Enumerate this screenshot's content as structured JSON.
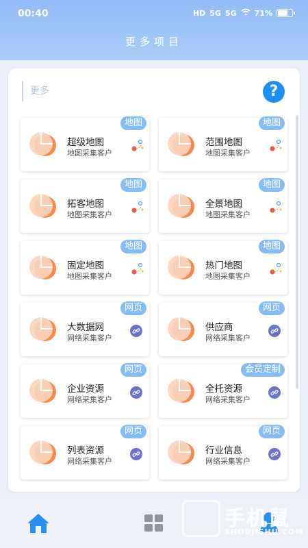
{
  "status_bar": {
    "time": "00:40",
    "hd": "HD",
    "signal1": "5G",
    "signal2": "5G",
    "battery": "71%"
  },
  "header": {
    "title": "更多项目"
  },
  "search": {
    "placeholder": "更多"
  },
  "cards": [
    {
      "name": "超级地图",
      "subtitle": "地图采集客户",
      "tag": "地图",
      "icon": "map-pin-icon"
    },
    {
      "name": "范围地图",
      "subtitle": "地图采集客户",
      "tag": "地图",
      "icon": "map-pin-icon"
    },
    {
      "name": "拓客地图",
      "subtitle": "地图采集客户",
      "tag": "地图",
      "icon": "map-pin-icon"
    },
    {
      "name": "全景地图",
      "subtitle": "地图采集客户",
      "tag": "地图",
      "icon": "map-pin-icon"
    },
    {
      "name": "固定地图",
      "subtitle": "地图采集客户",
      "tag": "地图",
      "icon": "map-pin-icon"
    },
    {
      "name": "热门地图",
      "subtitle": "地图采集客户",
      "tag": "地图",
      "icon": "map-pin-icon"
    },
    {
      "name": "大数据网",
      "subtitle": "网络采集客户",
      "tag": "网页",
      "icon": "link-icon"
    },
    {
      "name": "供应商",
      "subtitle": "网络采集客户",
      "tag": "网页",
      "icon": "link-icon"
    },
    {
      "name": "企业资源",
      "subtitle": "网络采集客户",
      "tag": "网页",
      "icon": "link-icon"
    },
    {
      "name": "全托资源",
      "subtitle": "网络采集客户",
      "tag": "会员定制",
      "icon": "link-icon"
    },
    {
      "name": "列表资源",
      "subtitle": "网络采集客户",
      "tag": "网页",
      "icon": "link-icon"
    },
    {
      "name": "行业信息",
      "subtitle": "网络采集客户",
      "tag": "网页",
      "icon": "link-icon"
    }
  ],
  "bottom_nav": {
    "items": [
      "home-icon",
      "grid-icon",
      "user-icon"
    ]
  },
  "watermark": {
    "text": "手机鼠",
    "sub": "SHOUJISHU.COM"
  },
  "colors": {
    "accent": "#1c8ff5",
    "tag": "#86bcf4",
    "logo": "#f58a4b",
    "link": "#6d72c9"
  }
}
